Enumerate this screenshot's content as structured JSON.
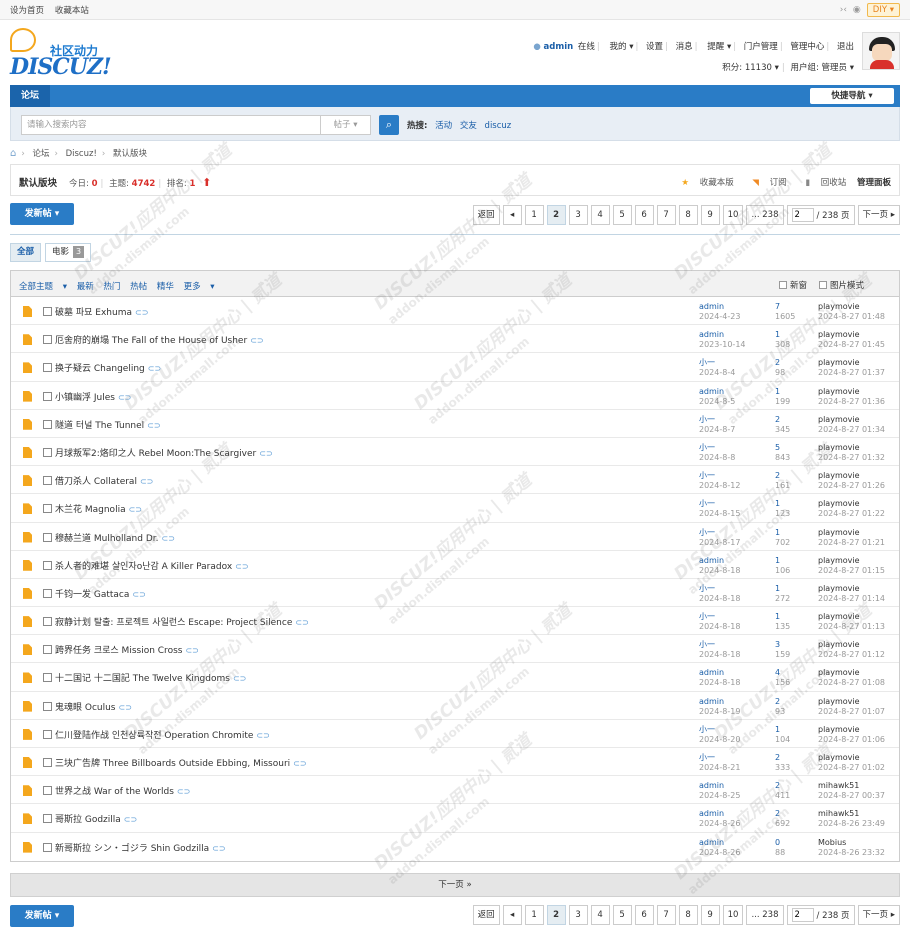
{
  "topbar": {
    "set_home": "设为首页",
    "bookmark": "收藏本站",
    "diy": "DIY"
  },
  "header": {
    "logo_cn": "社区动力",
    "logo_en": "DISCUZ!",
    "user": {
      "name": "admin",
      "online": "在线",
      "mine": "我的",
      "settings": "设置",
      "messages": "消息",
      "reminders": "提醒",
      "portal_admin": "门户管理",
      "admin_center": "管理中心",
      "logout": "退出",
      "credits": "积分: 11130",
      "usergroup": "用户组: 管理员"
    }
  },
  "nav": {
    "active": "论坛",
    "quick": "快捷导航"
  },
  "search": {
    "placeholder": "请输入搜索内容",
    "type": "帖子",
    "hot_label": "热搜:",
    "hot": [
      "活动",
      "交友",
      "discuz"
    ]
  },
  "breadcrumb": [
    "论坛",
    "Discuz!",
    "默认版块"
  ],
  "forum": {
    "name": "默认版块",
    "today_label": "今日:",
    "today": "0",
    "threads_label": "主题:",
    "threads": "4742",
    "rank_label": "排名:",
    "rank": "1",
    "fav": "收藏本版",
    "subscribe": "订阅",
    "recycle": "回收站",
    "manage": "管理面板"
  },
  "actions": {
    "new_post": "发新帖",
    "next_page": "下一页 »"
  },
  "pager": {
    "back": "返回",
    "pages": [
      "1",
      "2",
      "3",
      "4",
      "5",
      "6",
      "7",
      "8",
      "9",
      "10",
      "... 238"
    ],
    "current": "2",
    "total": "/ 238 页",
    "next": "下一页"
  },
  "tabs": [
    {
      "label": "全部"
    },
    {
      "label": "电影",
      "count": "3"
    }
  ],
  "filter": {
    "links": [
      "全部主题",
      "最新",
      "热门",
      "热帖",
      "精华",
      "更多"
    ],
    "new_window": "新窗",
    "image_mode": "图片模式"
  },
  "threads": [
    {
      "title": "破墓 파묘 Exhuma",
      "author": "admin",
      "date": "2024-4-23",
      "replies": "7",
      "views": "1605",
      "last_user": "playmovie",
      "last_time": "2024-8-27 01:48"
    },
    {
      "title": "厄舍府的崩塌 The Fall of the House of Usher",
      "author": "admin",
      "date": "2023-10-14",
      "replies": "1",
      "views": "308",
      "last_user": "playmovie",
      "last_time": "2024-8-27 01:45"
    },
    {
      "title": "换子疑云 Changeling",
      "author": "小一",
      "date": "2024-8-4",
      "replies": "2",
      "views": "98",
      "last_user": "playmovie",
      "last_time": "2024-8-27 01:37"
    },
    {
      "title": "小镇幽浮 Jules",
      "author": "admin",
      "date": "2024-8-5",
      "replies": "1",
      "views": "199",
      "last_user": "playmovie",
      "last_time": "2024-8-27 01:36"
    },
    {
      "title": "隧道 터널 The Tunnel",
      "author": "小一",
      "date": "2024-8-7",
      "replies": "2",
      "views": "345",
      "last_user": "playmovie",
      "last_time": "2024-8-27 01:34"
    },
    {
      "title": "月球叛军2:烙印之人 Rebel Moon:The Scargiver",
      "author": "小一",
      "date": "2024-8-8",
      "replies": "5",
      "views": "843",
      "last_user": "playmovie",
      "last_time": "2024-8-27 01:32"
    },
    {
      "title": "借刀杀人 Collateral",
      "author": "小一",
      "date": "2024-8-12",
      "replies": "2",
      "views": "161",
      "last_user": "playmovie",
      "last_time": "2024-8-27 01:26"
    },
    {
      "title": "木兰花 Magnolia",
      "author": "小一",
      "date": "2024-8-15",
      "replies": "1",
      "views": "123",
      "last_user": "playmovie",
      "last_time": "2024-8-27 01:22"
    },
    {
      "title": "穆赫兰道 Mulholland Dr.",
      "author": "小一",
      "date": "2024-8-17",
      "replies": "1",
      "views": "702",
      "last_user": "playmovie",
      "last_time": "2024-8-27 01:21"
    },
    {
      "title": "杀人者的难堪 살인자o난감 A Killer Paradox",
      "author": "admin",
      "date": "2024-8-18",
      "replies": "1",
      "views": "106",
      "last_user": "playmovie",
      "last_time": "2024-8-27 01:15"
    },
    {
      "title": "千钧一发 Gattaca",
      "author": "小一",
      "date": "2024-8-18",
      "replies": "1",
      "views": "272",
      "last_user": "playmovie",
      "last_time": "2024-8-27 01:14"
    },
    {
      "title": "寂静计划 탈출: 프로젝트 사일런스 Escape: Project Silence",
      "author": "小一",
      "date": "2024-8-18",
      "replies": "1",
      "views": "135",
      "last_user": "playmovie",
      "last_time": "2024-8-27 01:13"
    },
    {
      "title": "跨界任务 크로스 Mission Cross",
      "author": "小一",
      "date": "2024-8-18",
      "replies": "3",
      "views": "159",
      "last_user": "playmovie",
      "last_time": "2024-8-27 01:12"
    },
    {
      "title": "十二国记 十二国記 The Twelve Kingdoms",
      "author": "admin",
      "date": "2024-8-18",
      "replies": "4",
      "views": "156",
      "last_user": "playmovie",
      "last_time": "2024-8-27 01:08"
    },
    {
      "title": "鬼魂眼 Oculus",
      "author": "admin",
      "date": "2024-8-19",
      "replies": "2",
      "views": "93",
      "last_user": "playmovie",
      "last_time": "2024-8-27 01:07"
    },
    {
      "title": "仁川登陆作战 인천상륙작전 Operation Chromite",
      "author": "小一",
      "date": "2024-8-20",
      "replies": "1",
      "views": "104",
      "last_user": "playmovie",
      "last_time": "2024-8-27 01:06"
    },
    {
      "title": "三块广告牌 Three Billboards Outside Ebbing, Missouri",
      "author": "小一",
      "date": "2024-8-21",
      "replies": "2",
      "views": "333",
      "last_user": "playmovie",
      "last_time": "2024-8-27 01:02"
    },
    {
      "title": "世界之战 War of the Worlds",
      "author": "admin",
      "date": "2024-8-25",
      "replies": "2",
      "views": "411",
      "last_user": "mihawk51",
      "last_time": "2024-8-27 00:37"
    },
    {
      "title": "哥斯拉 Godzilla",
      "author": "admin",
      "date": "2024-8-26",
      "replies": "2",
      "views": "692",
      "last_user": "mihawk51",
      "last_time": "2024-8-26 23:49"
    },
    {
      "title": "新哥斯拉 シン・ゴジラ Shin Godzilla",
      "author": "admin",
      "date": "2024-8-26",
      "replies": "0",
      "views": "88",
      "last_user": "Mobius",
      "last_time": "2024-8-26 23:32"
    }
  ],
  "watermark": {
    "main": "DISCUZ!应用中心 | 贰道",
    "sub": "addon.dismall.com"
  }
}
